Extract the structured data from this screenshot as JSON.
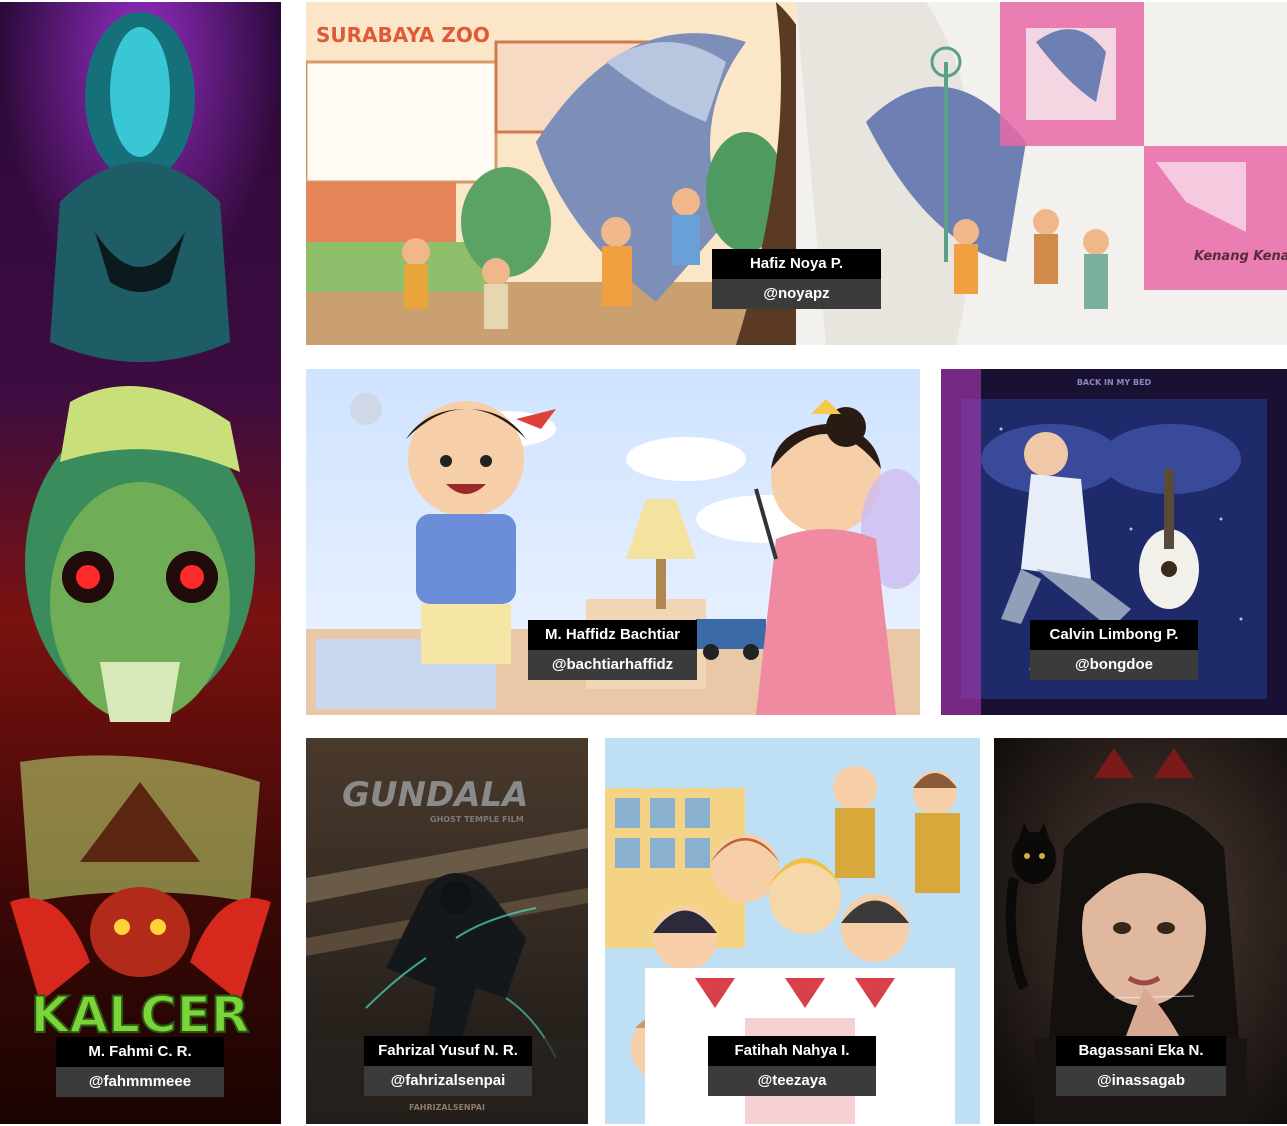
{
  "gallery": {
    "tiles": [
      {
        "id": "kalcer",
        "name": "M. Fahmi C. R.",
        "handle": "@fahmmmeee",
        "art_lettering": "KALCER"
      },
      {
        "id": "zoo",
        "name": "Hafiz Noya P.",
        "handle": "@noyapz",
        "art_lettering": "SURABAYA ZOO",
        "art_lettering_2": "Kenang Kenangan"
      },
      {
        "id": "fairy",
        "name": "M. Haffidz Bachtiar",
        "handle": "@bachtiarhaffidz"
      },
      {
        "id": "bed",
        "name": "Calvin Limbong P.",
        "handle": "@bongdoe",
        "art_lettering": "BACK IN MY BED"
      },
      {
        "id": "gundala",
        "name": "Fahrizal Yusuf N. R.",
        "handle": "@fahrizalsenpai",
        "art_lettering": "GUNDALA",
        "art_lettering_2": "GHOST TEMPLE FILM",
        "art_lettering_3": "FAHRIZALSENPAI"
      },
      {
        "id": "school",
        "name": "Fatihah Nahya I.",
        "handle": "@teezaya"
      },
      {
        "id": "portrait",
        "name": "Bagassani Eka N.",
        "handle": "@inassagab"
      }
    ]
  },
  "colors": {
    "name_bg": "#000000",
    "handle_bg": "#3b3b3b",
    "label_text": "#ffffff",
    "page_bg": "#ffffff"
  }
}
